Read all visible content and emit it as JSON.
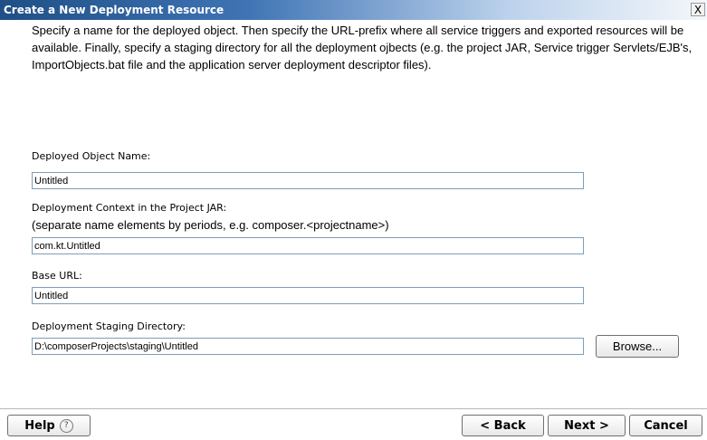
{
  "window": {
    "title": "Create a New Deployment Resource",
    "close_label": "X"
  },
  "intro_text": "Specify a name for the deployed object.  Then specify the URL-prefix where all service triggers and exported resources will be available.  Finally, specify a staging directory for all the deployment ojbects (e.g. the project JAR, Service trigger Servlets/EJB's, ImportObjects.bat file and the application server deployment descriptor files).",
  "fields": {
    "object_name": {
      "label": "Deployed Object Name:",
      "value": "Untitled"
    },
    "context": {
      "label": "Deployment Context in the Project JAR:",
      "sublabel": "(separate name elements by periods, e.g. composer.<projectname>)",
      "value": "com.kt.Untitled"
    },
    "base_url": {
      "label": "Base URL:",
      "value": "Untitled"
    },
    "staging_dir": {
      "label": "Deployment Staging Directory:",
      "value": "D:\\composerProjects\\staging\\Untitled",
      "browse_label": "Browse..."
    }
  },
  "buttons": {
    "help": "Help",
    "help_icon": "?",
    "back": "< Back",
    "next": "Next >",
    "cancel": "Cancel"
  }
}
